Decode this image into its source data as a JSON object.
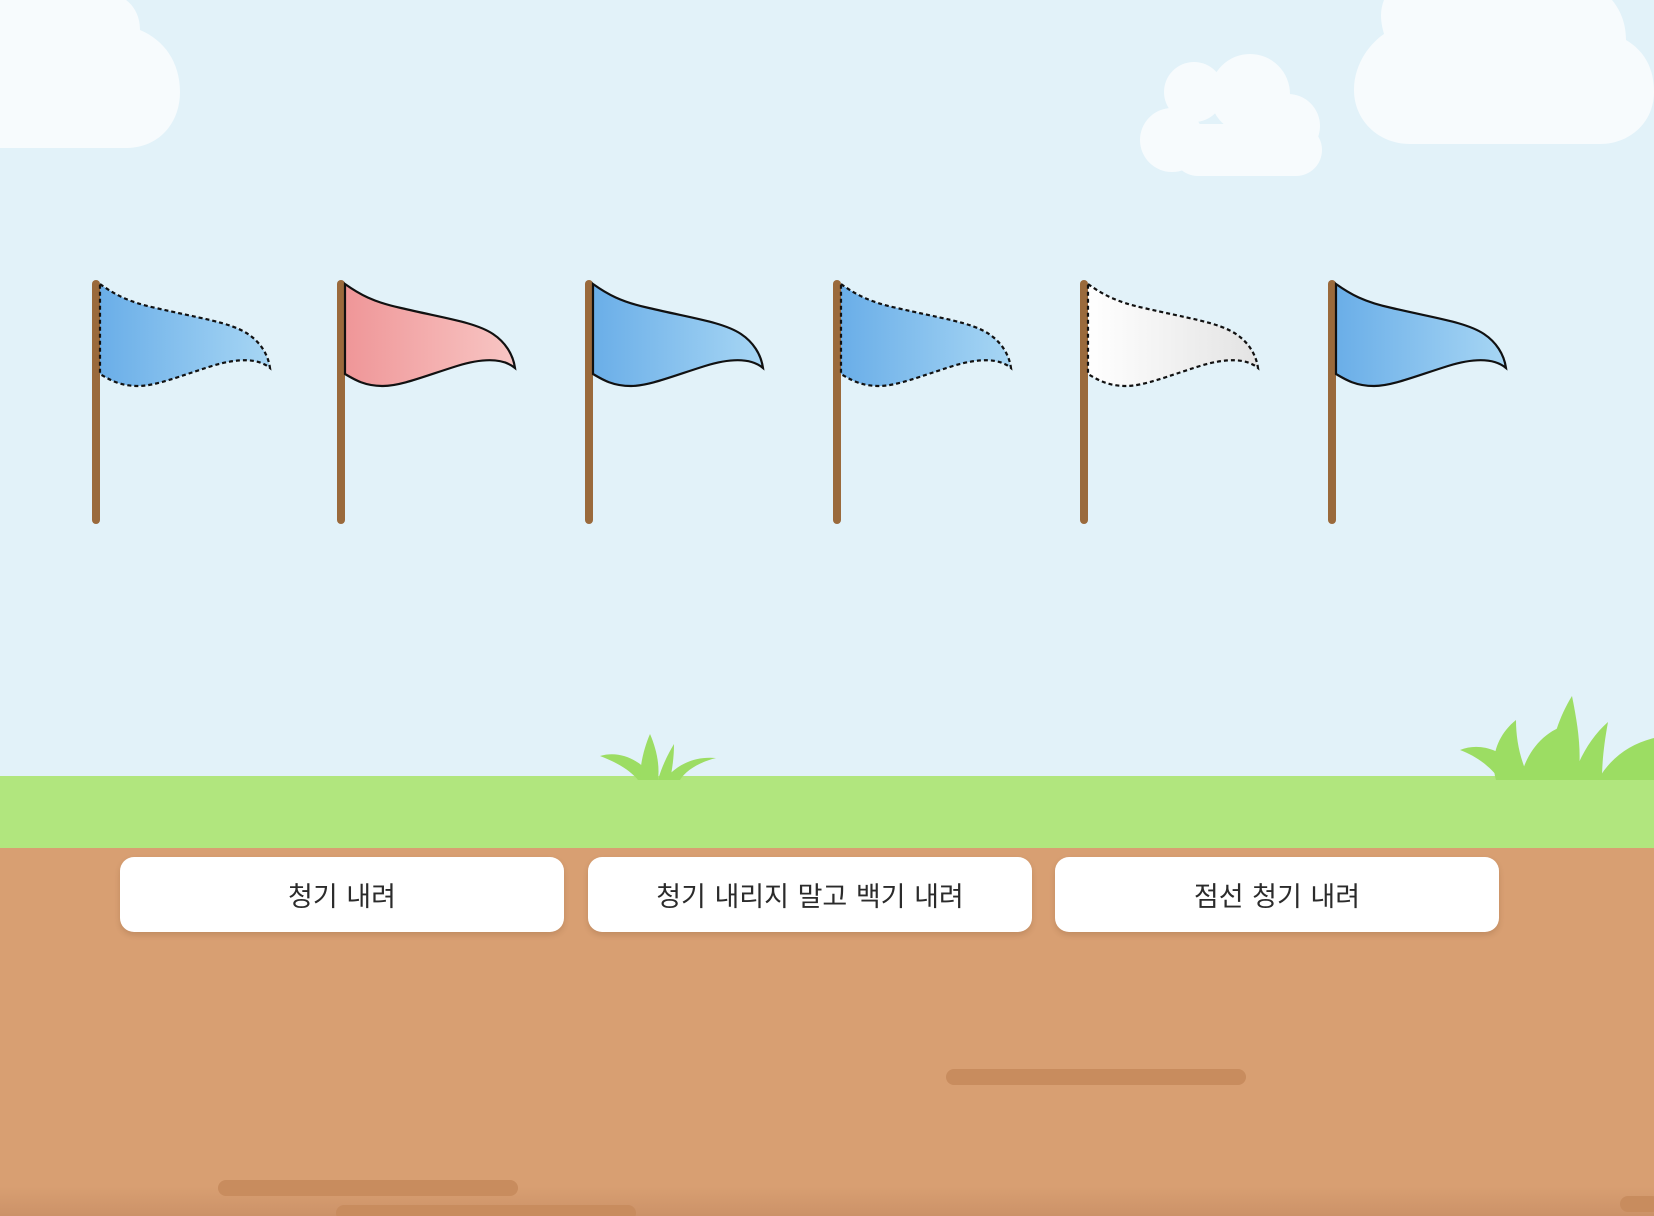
{
  "colors": {
    "sky": "#e2f2f9",
    "cloud": "#f7fbfd",
    "grass": "#b1e67e",
    "grass_tuft": "#9cdd63",
    "dirt": "#d89f72",
    "dirt_streak": "#c88c5e",
    "pole": "#9a6a3c",
    "blue_flag_start": "#6aaee8",
    "blue_flag_end": "#a7d6f4",
    "red_flag_start": "#ef9698",
    "red_flag_end": "#f8c6c4",
    "white_flag_start": "#ffffff",
    "white_flag_end": "#e3e3e3",
    "button_bg": "#ffffff",
    "button_text": "#2b2b2b"
  },
  "flags": [
    {
      "color": "blue",
      "outline": "dashed"
    },
    {
      "color": "red",
      "outline": "solid"
    },
    {
      "color": "blue",
      "outline": "solid"
    },
    {
      "color": "blue",
      "outline": "dashed"
    },
    {
      "color": "white",
      "outline": "dashed"
    },
    {
      "color": "blue",
      "outline": "solid"
    }
  ],
  "buttons": [
    {
      "label": "청기 내려"
    },
    {
      "label": "청기 내리지 말고 백기 내려"
    },
    {
      "label": "점선 청기 내려"
    }
  ]
}
